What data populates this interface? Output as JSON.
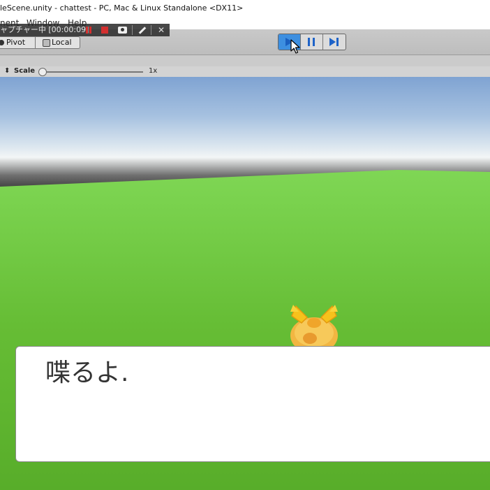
{
  "window": {
    "title": "leScene.unity - chattest - PC, Mac & Linux Standalone <DX11>"
  },
  "menu": {
    "items": [
      "nent",
      "Window",
      "Help"
    ]
  },
  "capture_overlay": {
    "status": "ャプチャー中 [00:00:09]"
  },
  "toolbar": {
    "pivot_label": "Pivot",
    "local_label": "Local"
  },
  "game_view": {
    "scale_label": "Scale",
    "scale_value": "1x",
    "scale_level": 0.0
  },
  "dialogue": {
    "text": "喋るよ."
  },
  "colors": {
    "play_active": "#3d8fe0",
    "grass": "#6cc43c",
    "sky": "#8fb0da",
    "capture_red": "#d32f2f"
  }
}
